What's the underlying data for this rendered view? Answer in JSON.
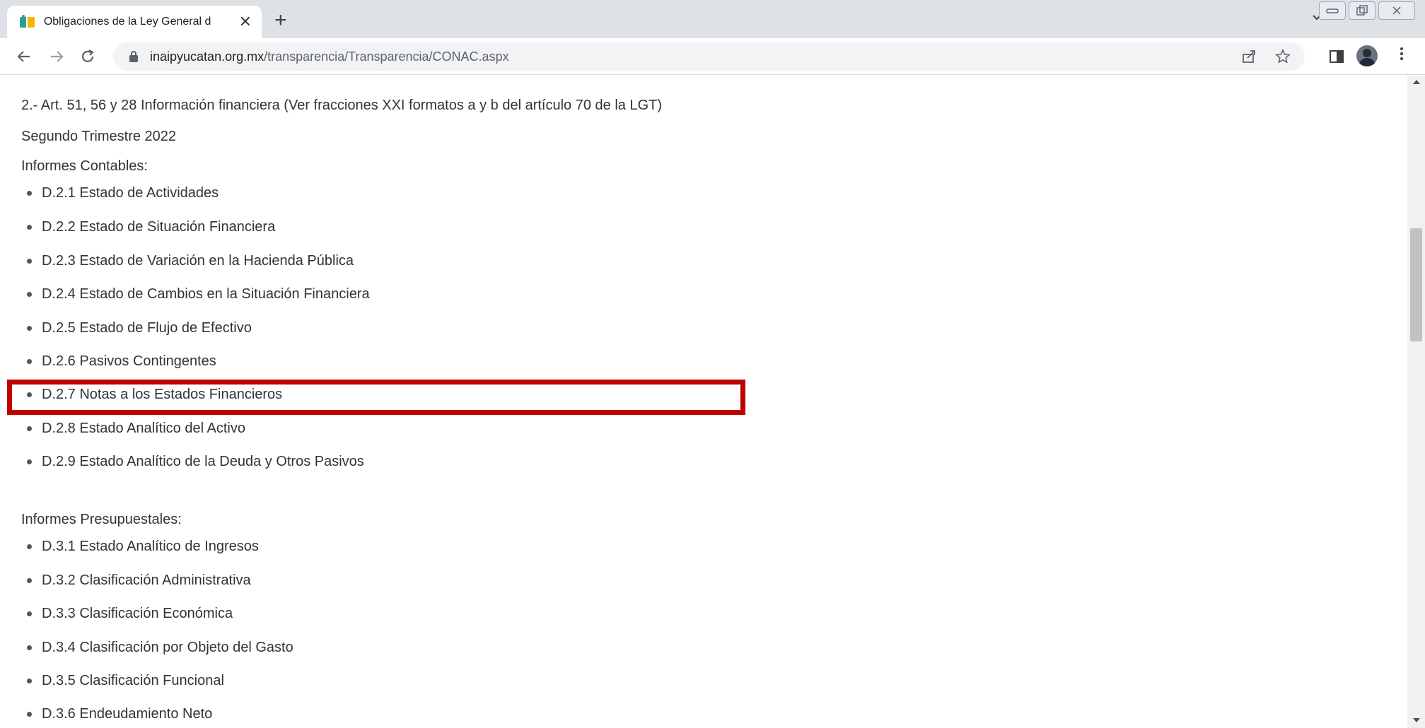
{
  "browser": {
    "tab_title": "Obligaciones de la Ley General d",
    "tab_close": "✕",
    "new_tab": "+",
    "url_host": "inaipyucatan.org.mx",
    "url_path": "/transparencia/Transparencia/CONAC.aspx",
    "icons": [
      "back-icon",
      "forward-icon",
      "reload-icon",
      "lock-icon",
      "share-icon",
      "star-icon",
      "side-panel-icon",
      "avatar",
      "menu-icon"
    ]
  },
  "page": {
    "heading": "2.- Art. 51, 56 y 28 Información financiera (Ver fracciones XXI formatos a y b del artículo 70 de la LGT)",
    "period": "Segundo Trimestre 2022",
    "contables_title": "Informes Contables:",
    "contables": [
      "D.2.1 Estado de Actividades",
      "D.2.2 Estado de Situación Financiera",
      "D.2.3 Estado de Variación en la Hacienda Pública",
      "D.2.4 Estado de Cambios en la Situación Financiera",
      "D.2.5 Estado de Flujo de Efectivo",
      "D.2.6 Pasivos Contingentes",
      "D.2.7 Notas a los Estados Financieros",
      "D.2.8 Estado Analítico del Activo",
      "D.2.9 Estado Analítico de la Deuda y Otros Pasivos"
    ],
    "presupuestales_title": "Informes Presupuestales:",
    "presupuestales": [
      "D.3.1 Estado Analítico de Ingresos",
      "D.3.2 Clasificación Administrativa",
      "D.3.3 Clasificación Económica",
      "D.3.4 Clasificación por Objeto del Gasto",
      "D.3.5 Clasificación Funcional",
      "D.3.6 Endeudamiento Neto"
    ],
    "highlight_color": "#c00000"
  }
}
